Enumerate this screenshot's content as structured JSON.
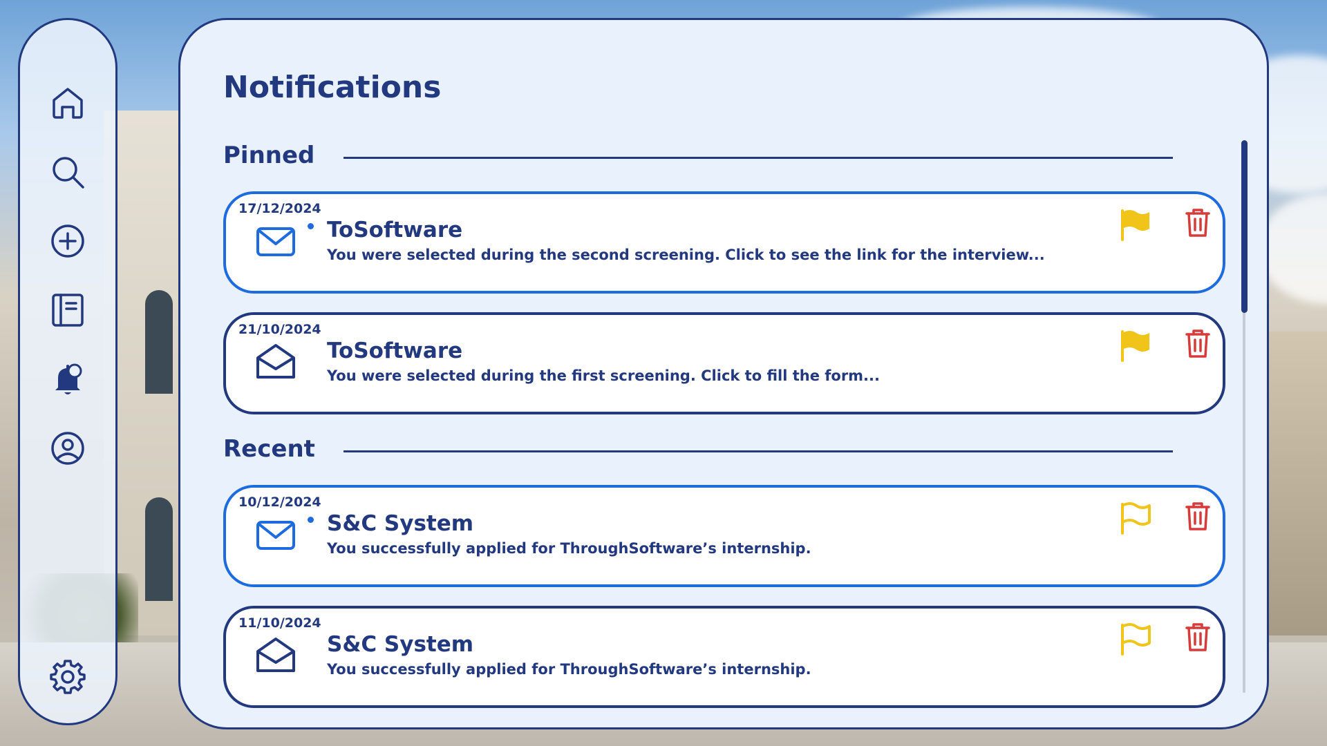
{
  "page": {
    "title": "Notifications"
  },
  "colors": {
    "primary": "#22387f",
    "accent_unread": "#1e6be0",
    "flag": "#f0c419",
    "trash": "#d83a3a",
    "panel_bg": "#e9f2fc"
  },
  "sidebar": {
    "items": [
      {
        "icon": "home-icon"
      },
      {
        "icon": "search-icon"
      },
      {
        "icon": "add-icon"
      },
      {
        "icon": "notebook-icon"
      },
      {
        "icon": "bell-icon",
        "active": true
      },
      {
        "icon": "profile-icon"
      },
      {
        "icon": "settings-icon"
      }
    ]
  },
  "sections": [
    {
      "label": "Pinned",
      "notifications": [
        {
          "date": "17/12/2024",
          "sender": "ToSoftware",
          "message": "You were selected during the second screening. Click to see the link for the interview...",
          "unread": true,
          "flagged": true
        },
        {
          "date": "21/10/2024",
          "sender": "ToSoftware",
          "message": "You were selected during the first screening. Click to fill the form...",
          "unread": false,
          "flagged": true
        }
      ]
    },
    {
      "label": "Recent",
      "notifications": [
        {
          "date": "10/12/2024",
          "sender": "S&C System",
          "message": "You successfully applied for ThroughSoftware’s internship.",
          "unread": true,
          "flagged": false
        },
        {
          "date": "11/10/2024",
          "sender": "S&C System",
          "message": "You successfully applied for ThroughSoftware’s internship.",
          "unread": false,
          "flagged": false
        }
      ]
    }
  ]
}
